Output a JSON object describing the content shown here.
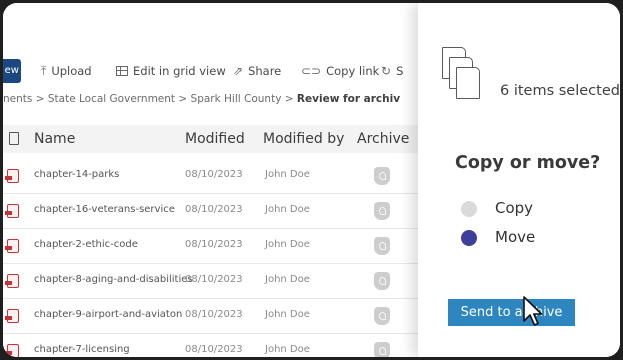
{
  "command_bar": {
    "new_label": "ew",
    "upload_label": "Upload",
    "edit_grid_label": "Edit in grid view",
    "share_label": "Share",
    "copy_link_label": "Copy link",
    "more_label": "S"
  },
  "breadcrumb": {
    "items": [
      "nents",
      "State Local Government",
      "Spark Hill County"
    ],
    "current": "Review for archiv",
    "separator": ">"
  },
  "columns": {
    "name": "Name",
    "modified": "Modified",
    "modified_by": "Modified by",
    "archive": "Archive"
  },
  "rows": [
    {
      "name": "chapter-14-parks",
      "modified": "08/10/2023",
      "modified_by": "John Doe"
    },
    {
      "name": "chapter-16-veterans-service",
      "modified": "08/10/2023",
      "modified_by": "John Doe"
    },
    {
      "name": "chapter-2-ethic-code",
      "modified": "08/10/2023",
      "modified_by": "John Doe"
    },
    {
      "name": "chapter-8-aging-and-disabilities",
      "modified": "08/10/2023",
      "modified_by": "John Doe"
    },
    {
      "name": "chapter-9-airport-and-aviaton",
      "modified": "08/10/2023",
      "modified_by": "John Doe"
    },
    {
      "name": "chapter-7-licensing",
      "modified": "08/10/2023",
      "modified_by": "John Doe"
    }
  ],
  "panel": {
    "selected_text": "6 items selected",
    "heading": "Copy or move?",
    "options": [
      {
        "label": "Copy",
        "selected": false
      },
      {
        "label": "Move",
        "selected": true
      }
    ],
    "send_button": "Send to archive"
  },
  "colors": {
    "accent": "#2e86c1",
    "brand": "#1c4780",
    "radio_selected": "#3d3f9a",
    "radio_unselected": "#dadada",
    "file_icon": "#c6343a"
  }
}
